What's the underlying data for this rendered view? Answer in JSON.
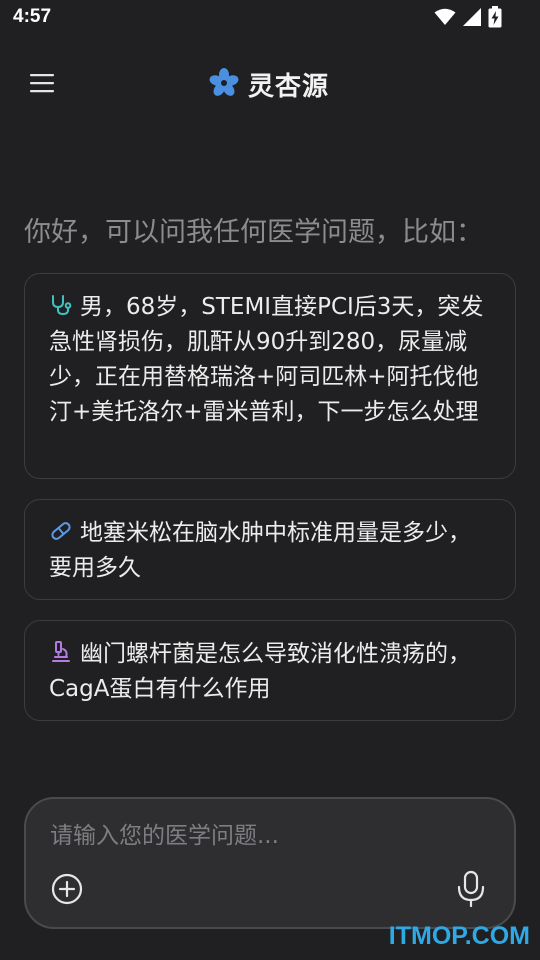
{
  "status_bar": {
    "time": "4:57",
    "icons": [
      "wifi-icon",
      "signal-icon",
      "battery-charging-icon"
    ]
  },
  "header": {
    "menu_icon": "hamburger-menu-icon",
    "logo_icon": "flower-logo-icon",
    "app_name": "灵杏源"
  },
  "greeting": "你好，可以问我任何医学问题，比如：",
  "suggestions": [
    {
      "icon": "stethoscope-icon",
      "icon_color": "#3FC3C0",
      "text": "男，68岁，STEMI直接PCI后3天，突发急性肾损伤，肌酐从90升到280，尿量减少，正在用替格瑞洛+阿司匹林+阿托伐他汀+美托洛尔+雷米普利，下一步怎么处理"
    },
    {
      "icon": "pill-icon",
      "icon_color": "#5A9BE8",
      "text": "地塞米松在脑水肿中标准用量是多少，要用多久"
    },
    {
      "icon": "microscope-icon",
      "icon_color": "#B27CE0",
      "text": "幽门螺杆菌是怎么导致消化性溃疡的，CagA蛋白有什么作用"
    }
  ],
  "input": {
    "placeholder": "请输入您的医学问题...",
    "value": "",
    "add_icon": "plus-circle-icon",
    "mic_icon": "microphone-icon"
  },
  "watermark": "ITMOP.COM",
  "colors": {
    "background": "#202022",
    "card_border": "#3C3C40",
    "logo": "#4A8FE0",
    "watermark": "#2FA8E6"
  }
}
